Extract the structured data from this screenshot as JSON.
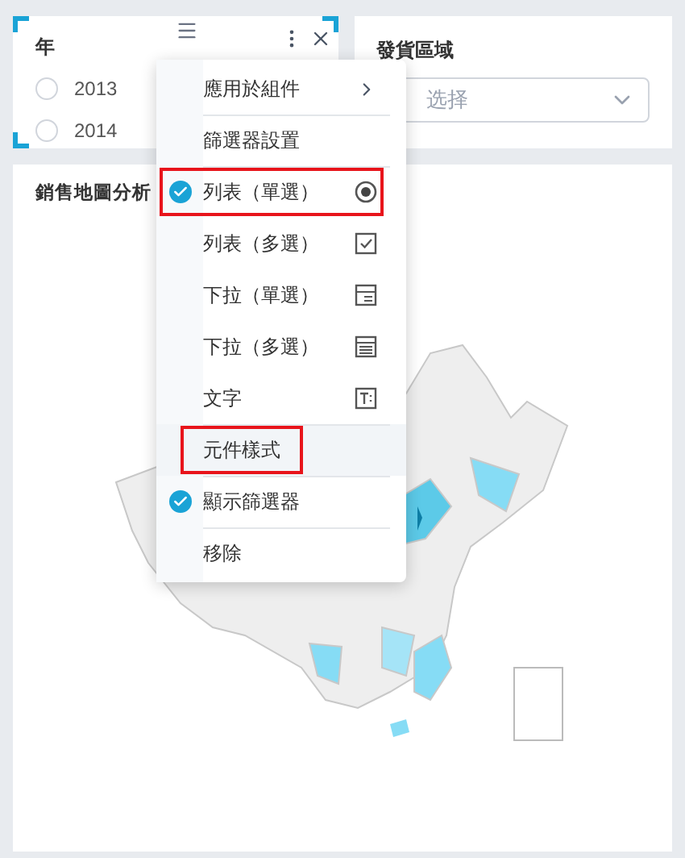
{
  "year_filter": {
    "title": "年",
    "options": [
      {
        "label": "2013",
        "selected": false
      },
      {
        "label": "2014",
        "selected": false
      }
    ]
  },
  "region_filter": {
    "title": "發貨區域",
    "placeholder": "选择"
  },
  "map_card": {
    "title": "銷售地圖分析"
  },
  "context_menu": {
    "items": [
      {
        "label": "應用於組件",
        "kind": "submenu",
        "checked": false,
        "highlighted": false,
        "hovered": false,
        "divider_before": false
      },
      {
        "label": "篩選器設置",
        "kind": "plain",
        "checked": false,
        "highlighted": false,
        "hovered": false,
        "divider_before": true
      },
      {
        "label": "列表（單選）",
        "kind": "radio",
        "checked": true,
        "highlighted": true,
        "hovered": false,
        "divider_before": true
      },
      {
        "label": "列表（多選）",
        "kind": "checkbox",
        "checked": false,
        "highlighted": false,
        "hovered": false,
        "divider_before": false
      },
      {
        "label": "下拉（單選）",
        "kind": "dropdown-single",
        "checked": false,
        "highlighted": false,
        "hovered": false,
        "divider_before": false
      },
      {
        "label": "下拉（多選）",
        "kind": "dropdown-multi",
        "checked": false,
        "highlighted": false,
        "hovered": false,
        "divider_before": false
      },
      {
        "label": "文字",
        "kind": "text",
        "checked": false,
        "highlighted": false,
        "hovered": false,
        "divider_before": false
      },
      {
        "label": "元件樣式",
        "kind": "plain",
        "checked": false,
        "highlighted": true,
        "hovered": true,
        "divider_before": true
      },
      {
        "label": "顯示篩選器",
        "kind": "plain",
        "checked": true,
        "highlighted": false,
        "hovered": false,
        "divider_before": true
      },
      {
        "label": "移除",
        "kind": "plain",
        "checked": false,
        "highlighted": false,
        "hovered": false,
        "divider_before": true
      }
    ]
  }
}
